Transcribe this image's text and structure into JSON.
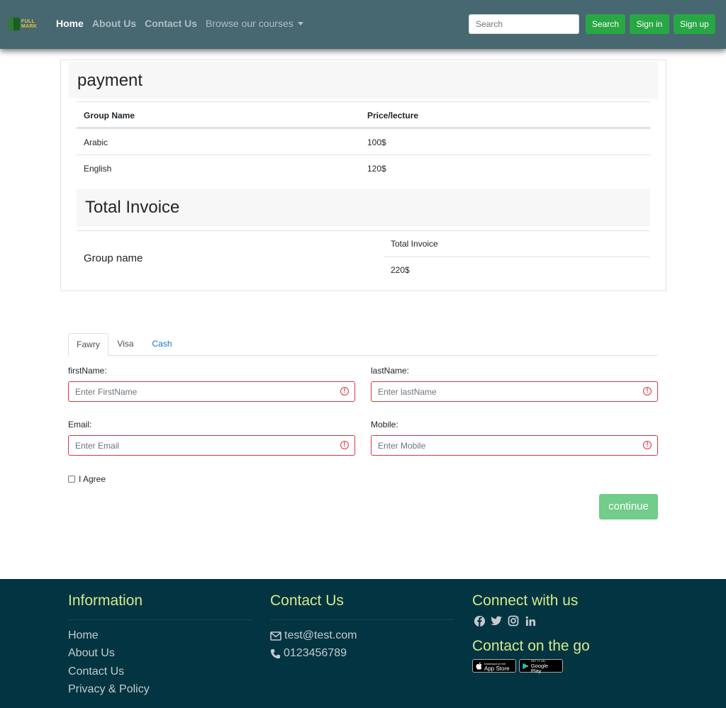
{
  "navbar": {
    "logo_text_line1": "FULL",
    "logo_text_line2": "MARK",
    "links": [
      "Home",
      "About Us",
      "Contact Us",
      "Browse our courses"
    ],
    "search_placeholder": "Search",
    "search_button": "Search",
    "signin": "Sign in",
    "signup": "Sign up"
  },
  "payment": {
    "title": "payment",
    "columns": [
      "Group Name",
      "Price/lecture"
    ],
    "rows": [
      {
        "group": "Arabic",
        "price": "100$"
      },
      {
        "group": "English",
        "price": "120$"
      }
    ],
    "total_title": "Total Invoice",
    "total_left_label": "Group name",
    "total_label": "Total Invoice",
    "total_value": "220$"
  },
  "tabs": [
    "Fawry",
    "Visa",
    "Cash"
  ],
  "form": {
    "first_label": "firstName:",
    "first_placeholder": "Enter FirstName",
    "last_label": "lastName:",
    "last_placeholder": "Enter lastName",
    "email_label": "Email:",
    "email_placeholder": "Enter Email",
    "mobile_label": "Mobile:",
    "mobile_placeholder": "Enter Mobile",
    "agree_label": "I Agree",
    "continue": "continue"
  },
  "footer": {
    "info_title": "Information",
    "info_links": [
      "Home",
      "About Us",
      "Contact Us",
      "Privacy & Policy"
    ],
    "contact_title": "Contact Us",
    "email": "test@test.com",
    "phone": "0123456789",
    "connect_title": "Connect with us",
    "go_title": "Contact on the go",
    "app_store_small": "Download on the",
    "app_store": "App Store",
    "google_play_small": "GET IT ON",
    "google_play": "Google Play"
  },
  "colors": {
    "navbar": "#476771",
    "green": "#28a745",
    "footer": "#033441",
    "footer_title": "#d3e98c",
    "invalid": "#dc3545"
  }
}
